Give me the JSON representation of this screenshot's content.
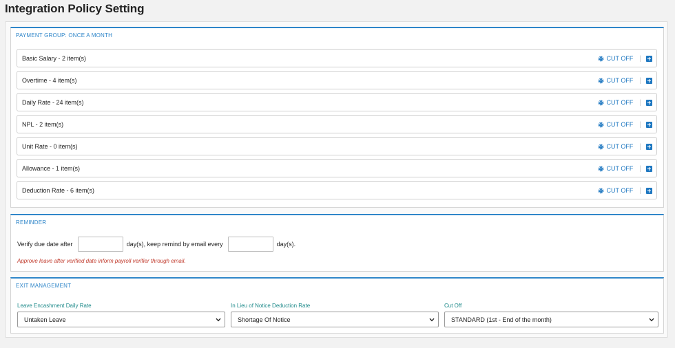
{
  "page": {
    "title": "Integration Policy Setting"
  },
  "payment_group": {
    "title": "PAYMENT GROUP: ONCE A MONTH",
    "cutoff_label": "CUT OFF",
    "rows": [
      {
        "label": "Basic Salary - 2 item(s)"
      },
      {
        "label": "Overtime - 4 item(s)"
      },
      {
        "label": "Daily Rate - 24 item(s)"
      },
      {
        "label": "NPL - 2 item(s)"
      },
      {
        "label": "Unit Rate - 0 item(s)"
      },
      {
        "label": "Allowance - 1 item(s)"
      },
      {
        "label": "Deduction Rate - 6 item(s)"
      }
    ]
  },
  "reminder": {
    "title": "REMINDER",
    "text_before": "Verify due date after",
    "text_middle": "day(s), keep remind by email every",
    "text_after": "day(s).",
    "verify_days_value": "",
    "remind_days_value": "",
    "note": "Approve leave after verified date inform payroll verifier through email."
  },
  "exit_management": {
    "title": "EXIT MANAGEMENT",
    "fields": [
      {
        "label": "Leave Encashment Daily Rate",
        "value": "Untaken Leave"
      },
      {
        "label": "In Lieu of Notice Deduction Rate",
        "value": "Shortage Of Notice"
      },
      {
        "label": "Cut Off",
        "value": "STANDARD (1st - End of the month)"
      }
    ]
  },
  "colors": {
    "accent": "#2f86c9",
    "link": "#1f78c1",
    "note": "#c0392b",
    "field_label": "#1e8a8a"
  }
}
